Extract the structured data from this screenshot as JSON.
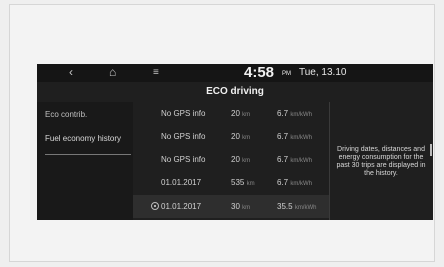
{
  "status_bar": {
    "back_icon": "back-arrow-icon",
    "home_icon": "home-icon",
    "menu_icon": "menu-icon",
    "time": "4:58",
    "ampm": "PM",
    "date": "Tue, 13.10"
  },
  "title": "ECO driving",
  "sidebar": {
    "items": [
      {
        "label": "Eco contrib."
      },
      {
        "label": "Fuel economy history"
      }
    ]
  },
  "trips": [
    {
      "name": "No GPS info",
      "distance": "20",
      "distance_unit": "km",
      "efficiency": "6.7",
      "efficiency_unit": "km/kWh"
    },
    {
      "name": "No GPS info",
      "distance": "20",
      "distance_unit": "km",
      "efficiency": "6.7",
      "efficiency_unit": "km/kWh"
    },
    {
      "name": "No GPS info",
      "distance": "20",
      "distance_unit": "km",
      "efficiency": "6.7",
      "efficiency_unit": "km/kWh"
    },
    {
      "name": "01.01.2017",
      "distance": "535",
      "distance_unit": "km",
      "efficiency": "6.7",
      "efficiency_unit": "km/kWh"
    },
    {
      "name": "01.01.2017",
      "distance": "30",
      "distance_unit": "km",
      "efficiency": "35.5",
      "efficiency_unit": "km/kWh"
    }
  ],
  "info_text": "Driving dates, distances and energy consumption for the past 30 trips are displayed in the history."
}
